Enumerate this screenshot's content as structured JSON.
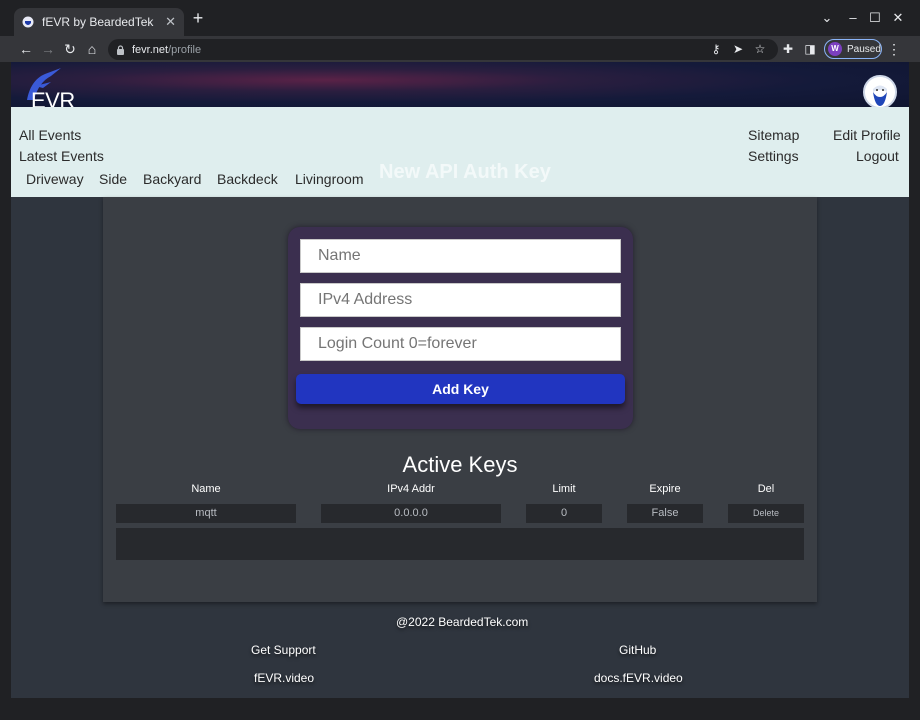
{
  "browser": {
    "tab_title": "fEVR by BeardedTek",
    "url_host": "fevr.net",
    "url_path": "/profile",
    "profile_initial": "W",
    "profile_status": "Paused"
  },
  "site": {
    "logo_text": "EVR"
  },
  "nav": {
    "all_events": "All Events",
    "latest_events": "Latest Events",
    "cameras": [
      "Driveway",
      "Side",
      "Backyard",
      "Backdeck",
      "Livingroom"
    ],
    "sitemap": "Sitemap",
    "settings": "Settings",
    "edit_profile": "Edit Profile",
    "logout": "Logout",
    "section_title": "New API Auth Key"
  },
  "form": {
    "name_placeholder": "Name",
    "ip_placeholder": "IPv4 Address",
    "count_placeholder": "Login Count 0=forever",
    "submit_label": "Add Key"
  },
  "keys": {
    "title": "Active Keys",
    "columns": [
      "Name",
      "IPv4 Addr",
      "Limit",
      "Expire",
      "Del"
    ],
    "rows": [
      {
        "name": "mqtt",
        "ip": "0.0.0.0",
        "limit": "0",
        "expire": "False",
        "del": "Delete"
      }
    ]
  },
  "footer": {
    "copyright": "@2022 BeardedTek.com",
    "support": "Get Support",
    "github": "GitHub",
    "site": "fEVR.video",
    "docs": "docs.fEVR.video"
  },
  "colors": {
    "add_button": "#2135c0",
    "navbar": "#dfeeee",
    "page_bg": "#2f353e"
  }
}
